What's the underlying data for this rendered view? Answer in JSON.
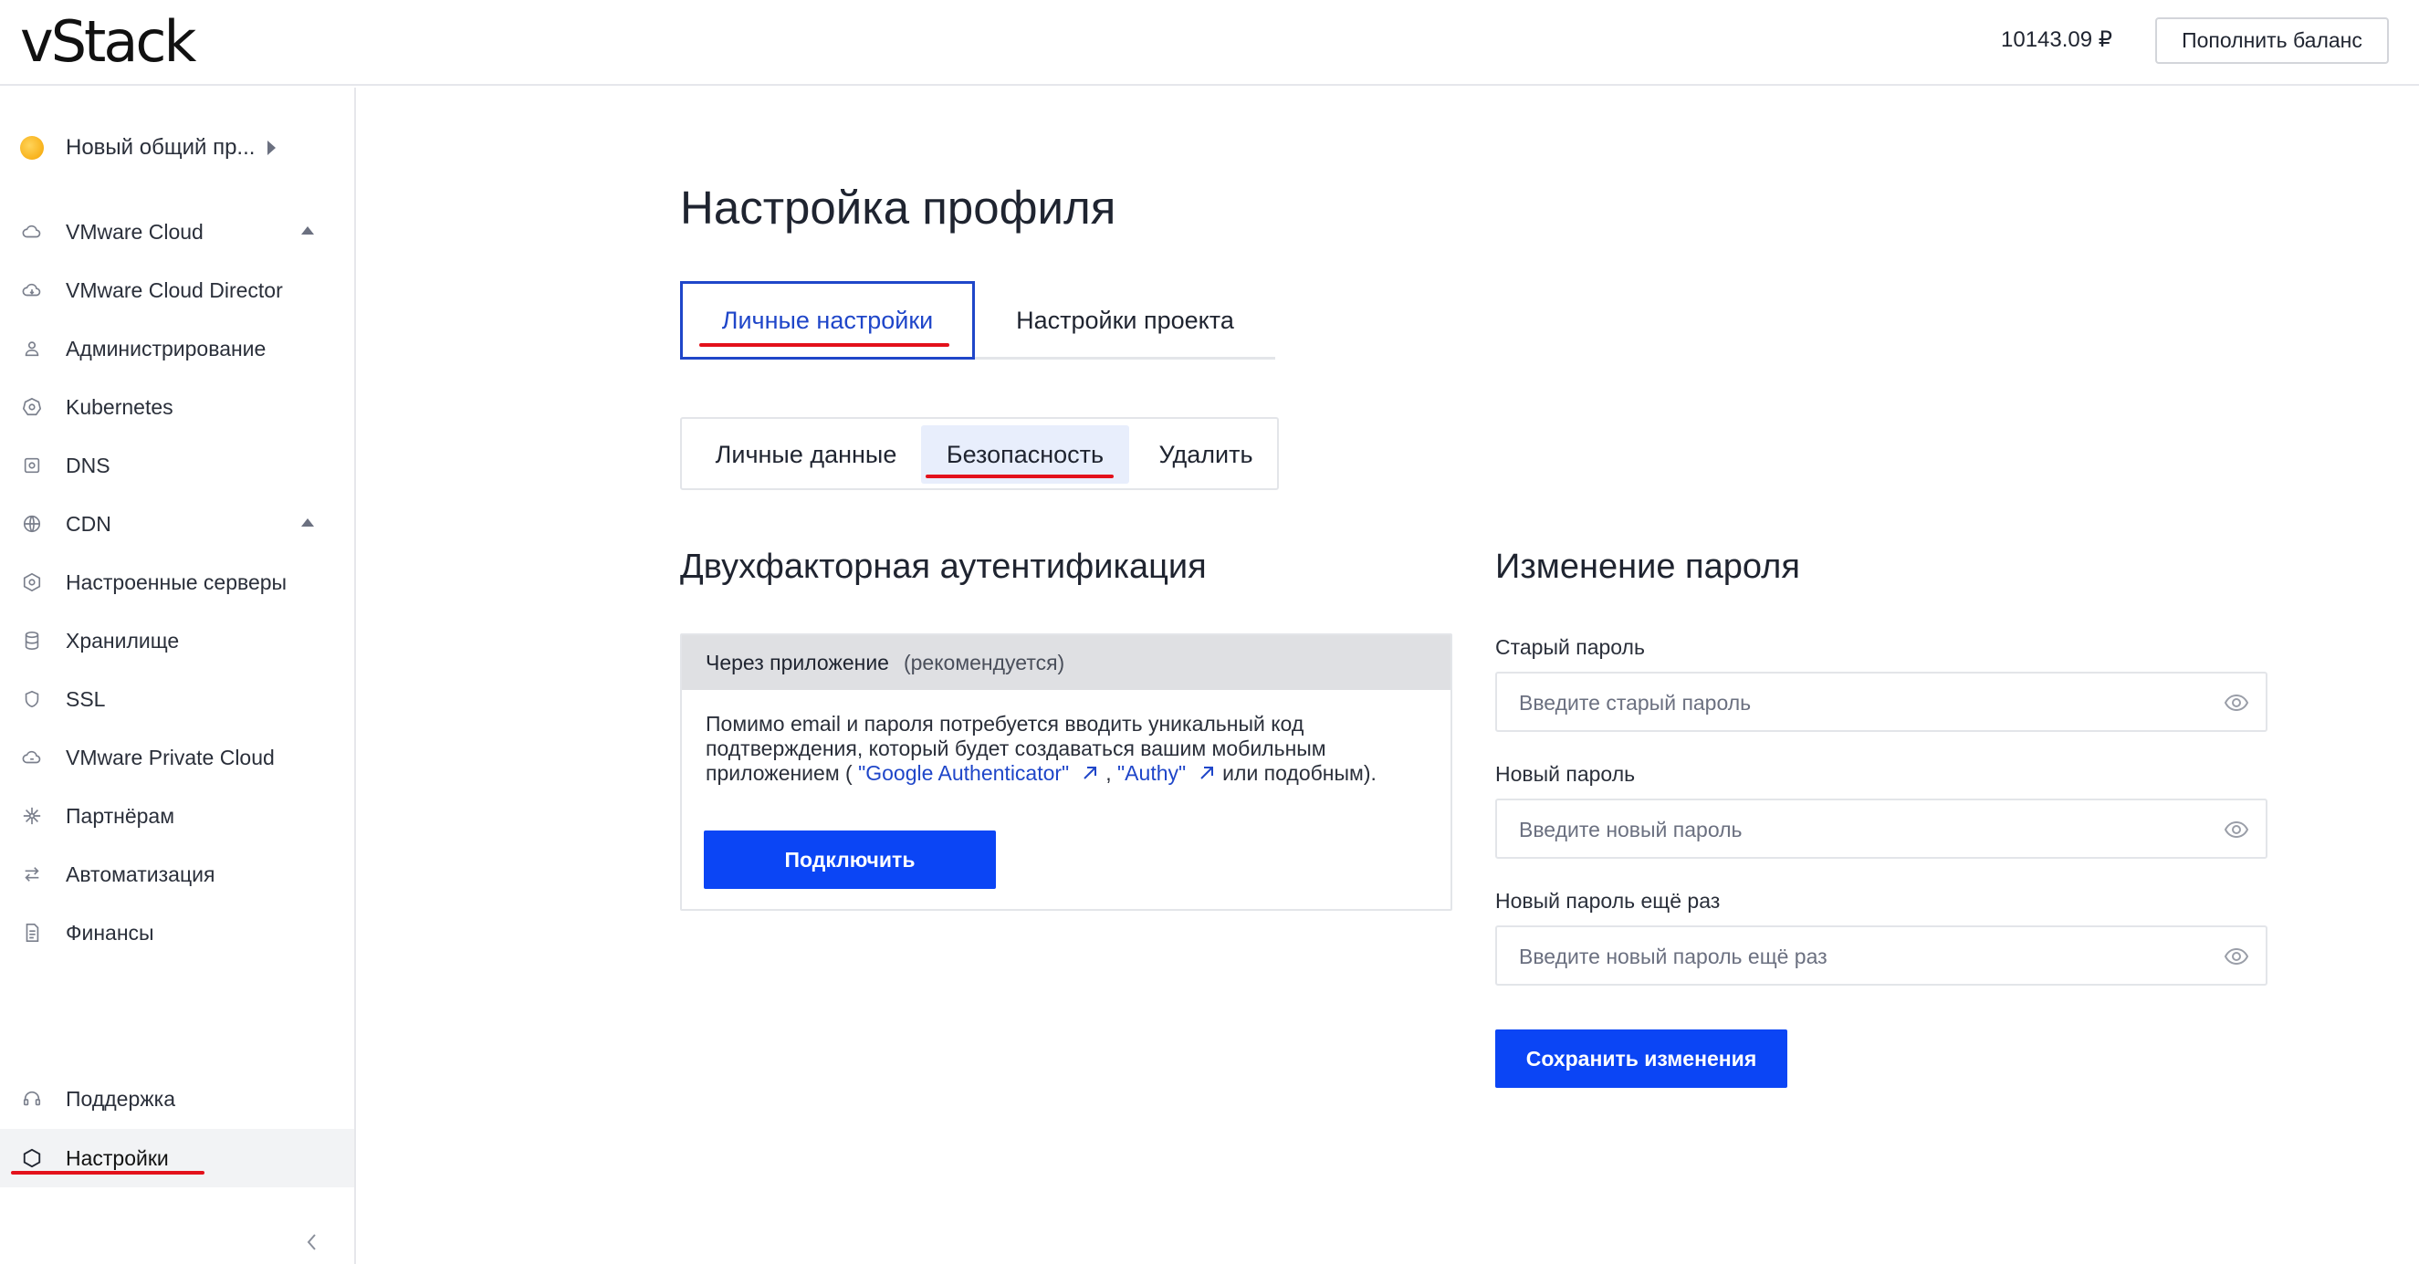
{
  "header": {
    "logo": "vStack",
    "balance": "10143.09 ₽",
    "topup_label": "Пополнить баланс"
  },
  "sidebar": {
    "project_name": "Новый общий пр...",
    "items": [
      {
        "label": "VMware Cloud",
        "icon": "cloud-icon",
        "expandable": true
      },
      {
        "label": "VMware Cloud Director",
        "icon": "cloud-icon"
      },
      {
        "label": "Администрирование",
        "icon": "person-icon"
      },
      {
        "label": "Kubernetes",
        "icon": "kubernetes-icon"
      },
      {
        "label": "DNS",
        "icon": "dns-icon"
      },
      {
        "label": "CDN",
        "icon": "globe-icon",
        "expandable": true
      },
      {
        "label": "Настроенные серверы",
        "icon": "hexagon-icon"
      },
      {
        "label": "Хранилище",
        "icon": "database-icon"
      },
      {
        "label": "SSL",
        "icon": "shield-icon"
      },
      {
        "label": "VMware Private Cloud",
        "icon": "cloud-icon"
      },
      {
        "label": "Партнёрам",
        "icon": "network-icon"
      },
      {
        "label": "Автоматизация",
        "icon": "arrows-icon"
      },
      {
        "label": "Финансы",
        "icon": "document-icon"
      }
    ],
    "support": "Поддержка",
    "settings": "Настройки"
  },
  "main": {
    "title": "Настройка профиля",
    "tabs": [
      "Личные настройки",
      "Настройки проекта"
    ],
    "subtabs": [
      "Личные данные",
      "Безопасность",
      "Удалить"
    ],
    "twofa": {
      "title": "Двухфакторная аутентификация",
      "method": "Через приложение",
      "recommended": "(рекомендуется)",
      "text_1": "Помимо email и пароля потребуется вводить уникальный код",
      "text_2": "подтверждения, который будет создаваться вашим мобильным",
      "text_3_pre": "приложением ( ",
      "link_1": "\"Google Authenticator\"",
      "comma": ", ",
      "link_2": "\"Authy\"",
      "text_3_post": "или подобным).",
      "connect_label": "Подключить"
    },
    "password": {
      "title": "Изменение пароля",
      "old_label": "Старый пароль",
      "old_placeholder": "Введите старый пароль",
      "new_label": "Новый пароль",
      "new_placeholder": "Введите новый пароль",
      "repeat_label": "Новый пароль ещё раз",
      "repeat_placeholder": "Введите новый пароль ещё раз",
      "save_label": "Сохранить изменения"
    }
  },
  "colors": {
    "accent": "#0b45f5",
    "tab_active": "#1f46c9",
    "annotation": "#e3111b",
    "project_dot": "#f5a300"
  }
}
